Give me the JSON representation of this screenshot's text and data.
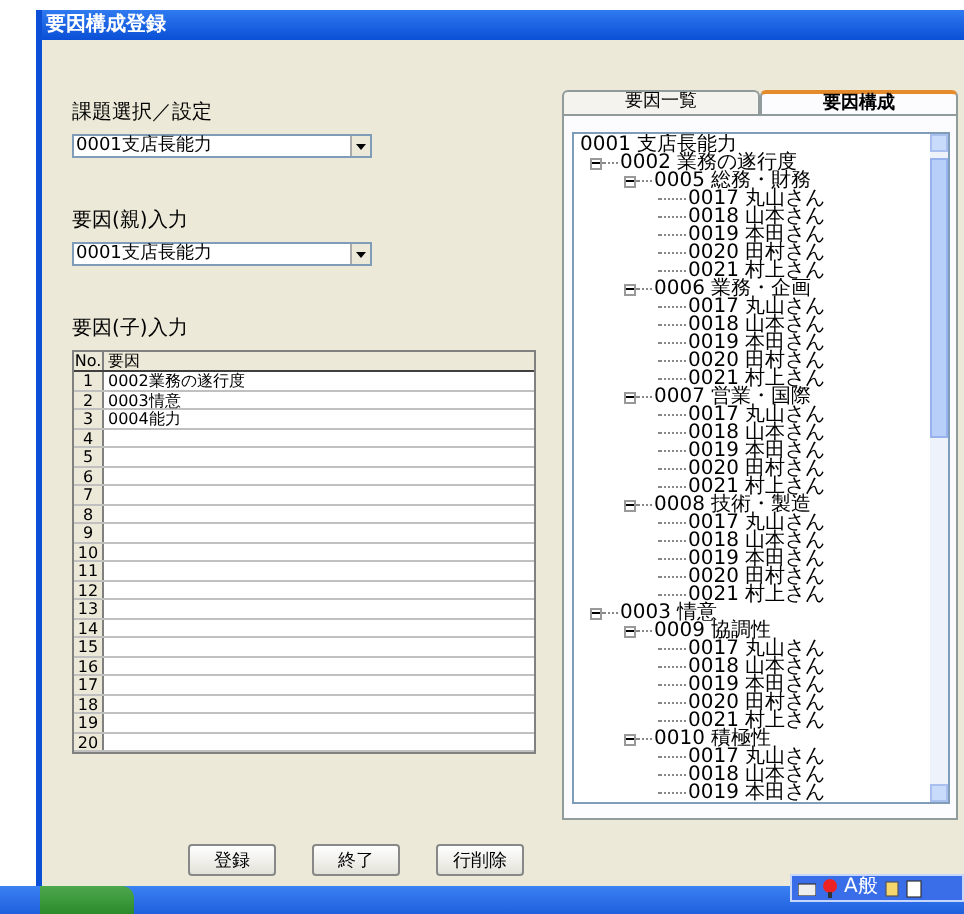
{
  "window": {
    "title": "要因構成登録"
  },
  "left": {
    "subject_label": "課題選択／設定",
    "subject_combo": {
      "value": "0001支店長能力"
    },
    "parent_label": "要因(親)入力",
    "parent_combo": {
      "value": "0001支店長能力"
    },
    "child_label": "要因(子)入力",
    "grid": {
      "columns": [
        "No.",
        "要因"
      ],
      "rows": [
        {
          "no": "1",
          "factor": "0002業務の遂行度"
        },
        {
          "no": "2",
          "factor": "0003情意"
        },
        {
          "no": "3",
          "factor": "0004能力"
        },
        {
          "no": "4"
        },
        {
          "no": "5"
        },
        {
          "no": "6"
        },
        {
          "no": "7"
        },
        {
          "no": "8"
        },
        {
          "no": "9"
        },
        {
          "no": "10"
        },
        {
          "no": "11"
        },
        {
          "no": "12"
        },
        {
          "no": "13"
        },
        {
          "no": "14"
        },
        {
          "no": "15"
        },
        {
          "no": "16"
        },
        {
          "no": "17"
        },
        {
          "no": "18"
        },
        {
          "no": "19"
        },
        {
          "no": "20"
        }
      ]
    }
  },
  "buttons": [
    "登録",
    "終了",
    "行削除"
  ],
  "tabs": [
    {
      "label": "要因一覧",
      "selected": false
    },
    {
      "label": "要因構成",
      "selected": true
    }
  ],
  "tree": [
    {
      "label": "0001 支店長能力",
      "children": [
        {
          "label": "0002 業務の遂行度",
          "expanded": true,
          "children": [
            {
              "label": "0005 総務・財務",
              "expanded": true,
              "children": [
                {
                  "label": "0017 丸山さん"
                },
                {
                  "label": "0018 山本さん"
                },
                {
                  "label": "0019 本田さん"
                },
                {
                  "label": "0020 田村さん"
                },
                {
                  "label": "0021 村上さん"
                }
              ]
            },
            {
              "label": "0006 業務・企画",
              "expanded": true,
              "children": [
                {
                  "label": "0017 丸山さん"
                },
                {
                  "label": "0018 山本さん"
                },
                {
                  "label": "0019 本田さん"
                },
                {
                  "label": "0020 田村さん"
                },
                {
                  "label": "0021 村上さん"
                }
              ]
            },
            {
              "label": "0007 営業・国際",
              "expanded": true,
              "children": [
                {
                  "label": "0017 丸山さん"
                },
                {
                  "label": "0018 山本さん"
                },
                {
                  "label": "0019 本田さん"
                },
                {
                  "label": "0020 田村さん"
                },
                {
                  "label": "0021 村上さん"
                }
              ]
            },
            {
              "label": "0008 技術・製造",
              "expanded": true,
              "children": [
                {
                  "label": "0017 丸山さん"
                },
                {
                  "label": "0018 山本さん"
                },
                {
                  "label": "0019 本田さん"
                },
                {
                  "label": "0020 田村さん"
                },
                {
                  "label": "0021 村上さん"
                }
              ]
            }
          ]
        },
        {
          "label": "0003 情意",
          "expanded": true,
          "children": [
            {
              "label": "0009 協調性",
              "expanded": true,
              "children": [
                {
                  "label": "0017 丸山さん"
                },
                {
                  "label": "0018 山本さん"
                },
                {
                  "label": "0019 本田さん"
                },
                {
                  "label": "0020 田村さん"
                },
                {
                  "label": "0021 村上さん"
                }
              ]
            },
            {
              "label": "0010 積極性",
              "expanded": true,
              "children": [
                {
                  "label": "0017 丸山さん"
                },
                {
                  "label": "0018 山本さん"
                },
                {
                  "label": "0019 本田さん"
                }
              ]
            }
          ]
        }
      ]
    }
  ],
  "language_bar": {
    "ime_mode": "A般"
  }
}
